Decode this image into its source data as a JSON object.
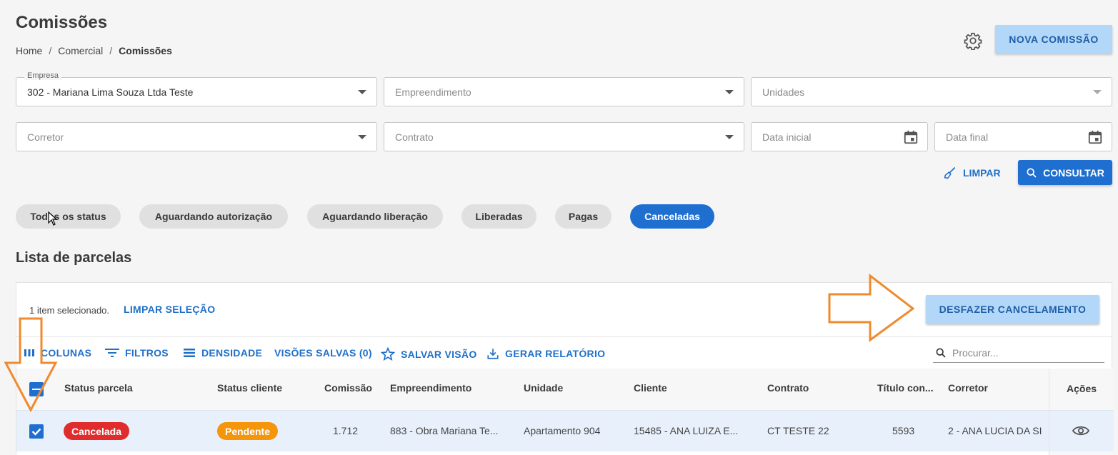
{
  "header": {
    "title": "Comissões",
    "breadcrumb": [
      "Home",
      "Comercial",
      "Comissões"
    ],
    "breadcrumb_sep": "/",
    "new_button": "NOVA COMISSÃO"
  },
  "filters": {
    "empresa_label": "Empresa",
    "empresa_value": "302 - Mariana  Lima Souza Ltda Teste",
    "empreendimento_placeholder": "Empreendimento",
    "unidades_placeholder": "Unidades",
    "corretor_placeholder": "Corretor",
    "contrato_placeholder": "Contrato",
    "data_inicial_placeholder": "Data inicial",
    "data_final_placeholder": "Data final",
    "limpar": "LIMPAR",
    "consultar": "CONSULTAR"
  },
  "status_chips": [
    "Todos os status",
    "Aguardando autorização",
    "Aguardando liberação",
    "Liberadas",
    "Pagas",
    "Canceladas"
  ],
  "active_chip": "Canceladas",
  "list": {
    "title": "Lista de parcelas",
    "selection_text": "1 item selecionado.",
    "clear_selection": "LIMPAR SELEÇÃO",
    "undo_cancel": "DESFAZER CANCELAMENTO",
    "toolbar": {
      "colunas": "COLUNAS",
      "filtros": "FILTROS",
      "densidade": "DENSIDADE",
      "visoes": "VISÕES SALVAS (0)",
      "salvar": "SALVAR VISÃO",
      "relatorio": "GERAR RELATÓRIO",
      "search_placeholder": "Procurar..."
    },
    "columns": [
      "Status parcela",
      "Status cliente",
      "Comissão",
      "Empreendimento",
      "Unidade",
      "Cliente",
      "Contrato",
      "Título con...",
      "Corretor",
      "Ações"
    ],
    "rows": [
      {
        "status_parcela": "Cancelada",
        "status_cliente": "Pendente",
        "comissao": "1.712",
        "empreendimento": "883 - Obra Mariana Te...",
        "unidade": "Apartamento 904",
        "cliente": "15485 - ANA LUIZA E...",
        "contrato": "CT TESTE 22",
        "titulo": "5593",
        "corretor": "2 - ANA LUCIA DA SI"
      }
    ]
  },
  "colors": {
    "primary": "#1f6fd1",
    "light_button": "#b3d7f8",
    "cancelada": "#e02c2c",
    "pendente": "#f5950a",
    "annotation_arrow": "#f08a2e"
  }
}
